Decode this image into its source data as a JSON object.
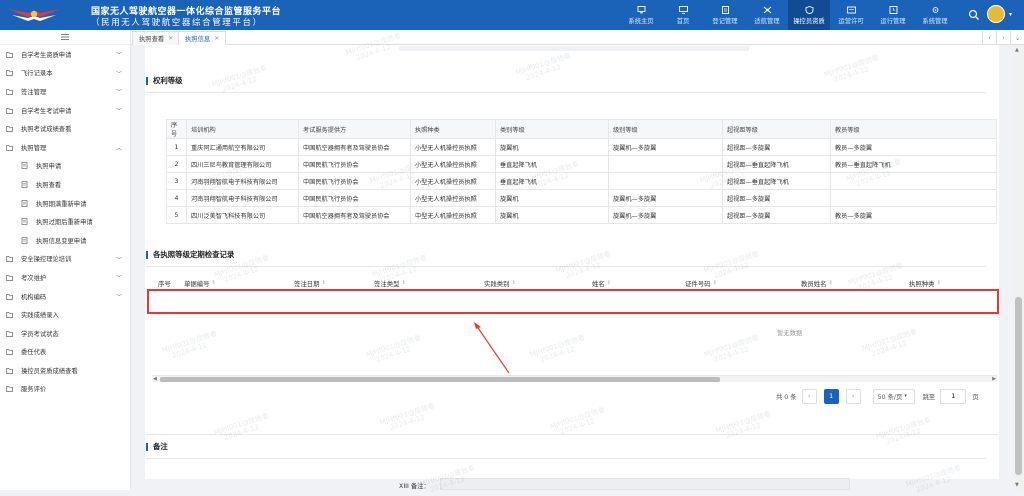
{
  "app": {
    "title_line1": "国家无人驾驶航空器一体化综合监管服务平台",
    "title_line2": "（民用无人驾驶航空器综合管理平台）"
  },
  "nav": [
    {
      "label": "系统主页",
      "icon": "home-screen-icon"
    },
    {
      "label": "首页",
      "icon": "monitor-icon"
    },
    {
      "label": "登记管理",
      "icon": "document-icon"
    },
    {
      "label": "适航管理",
      "icon": "drone-icon"
    },
    {
      "label": "操控员资质",
      "icon": "shield-icon",
      "active": true
    },
    {
      "label": "运营许可",
      "icon": "card-icon"
    },
    {
      "label": "运行管理",
      "icon": "clock-icon"
    },
    {
      "label": "系统管理",
      "icon": "settings-icon"
    }
  ],
  "sidebar": {
    "collapse_icon": "menu-icon",
    "items": [
      {
        "label": "自学考生资质申请",
        "arrow": true
      },
      {
        "label": "飞行记录本",
        "arrow": true
      },
      {
        "label": "签注管理",
        "arrow": true
      },
      {
        "label": "自学考生考试申请",
        "arrow": true
      },
      {
        "label": "执照考试成绩查看",
        "arrow": false
      },
      {
        "label": "执照管理",
        "arrow": true,
        "expanded": true
      },
      {
        "label": "执照申请",
        "sub": true
      },
      {
        "label": "执照查看",
        "sub": true
      },
      {
        "label": "执照期满重新申请",
        "sub": true
      },
      {
        "label": "执照过期后重新申请",
        "sub": true
      },
      {
        "label": "执照信息变更申请",
        "sub": true
      },
      {
        "label": "安全操控理论培训",
        "arrow": true
      },
      {
        "label": "考次维护",
        "arrow": true
      },
      {
        "label": "机构编码",
        "arrow": true
      },
      {
        "label": "实践成绩录入",
        "arrow": false
      },
      {
        "label": "学员考试状态",
        "arrow": false
      },
      {
        "label": "委任代表",
        "arrow": false
      },
      {
        "label": "操控员资质成绩查看",
        "arrow": false
      },
      {
        "label": "服务评价",
        "arrow": false
      }
    ]
  },
  "tabs": [
    {
      "label": "执照查看",
      "active": false
    },
    {
      "label": "执照信息",
      "active": true
    }
  ],
  "rights": {
    "title": "权利等级",
    "columns": [
      "序号",
      "培训机构",
      "考试服务提供方",
      "执照种类",
      "类别等级",
      "级别等级",
      "超视距等级",
      "教员等级"
    ],
    "rows": [
      [
        "1",
        "重庆阿汇通用航空有限公司",
        "中国航空器拥有者及驾驶员协会",
        "小型无人机操控员执照",
        "旋翼机",
        "旋翼机—多旋翼",
        "超视距—多旋翼",
        "教员—多旋翼"
      ],
      [
        "2",
        "四川三尼鸟教育管理有限公司",
        "中国民航飞行员协会",
        "小型无人机操控员执照",
        "垂直起降飞机",
        "",
        "超视距—垂直起降飞机",
        "教员—垂直起降飞机"
      ],
      [
        "3",
        "河南羽翔智航电子科技有限公司",
        "中国民航飞行员协会",
        "小型无人机操控员执照",
        "垂直起降飞机",
        "",
        "超视距—垂直起降飞机",
        ""
      ],
      [
        "4",
        "河南羽翔智航电子科技有限公司",
        "中国民航飞行员协会",
        "小型无人机操控员执照",
        "旋翼机",
        "旋翼机—多旋翼",
        "超视距—多旋翼",
        ""
      ],
      [
        "5",
        "四川泛美智飞科技有限公司",
        "中国航空器拥有者及驾驶员协会",
        "中型无人机操控员执照",
        "旋翼机",
        "旋翼机—多旋翼",
        "超视距—多旋翼",
        "教员—多旋翼"
      ]
    ]
  },
  "records": {
    "title": "各执照等级定期检查记录",
    "columns": [
      "序号",
      "单据编号",
      "签注日期",
      "签注类型",
      "实践类别",
      "姓名",
      "证件号码",
      "教员姓名",
      "执照种类"
    ],
    "empty_text": "暂无数据"
  },
  "pagination": {
    "total_text": "共 0 条",
    "current_page": "1",
    "page_size": "50 条/页",
    "goto_label": "跳至",
    "goto_value": "1",
    "page_suffix": "页"
  },
  "remarks": {
    "title": "备注",
    "field_label": "XIII 备注："
  },
  "watermark": {
    "line1": "MJHf001@旋驰者",
    "line2": "2024-4-12"
  },
  "colors": {
    "header_blue": "#1b63b8",
    "highlight_red": "#e53935",
    "accent": "#1b63b8"
  }
}
